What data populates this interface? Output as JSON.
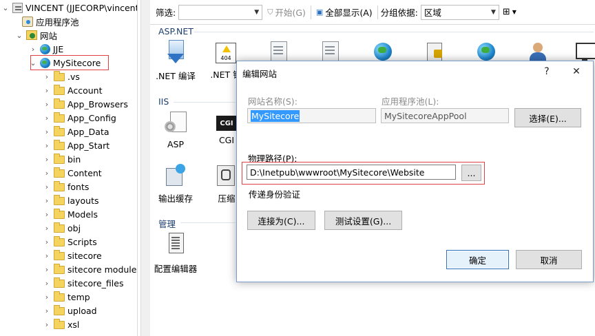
{
  "tree": {
    "server": "VINCENT (JJECORP\\vincent",
    "app_pools": "应用程序池",
    "sites": "网站",
    "site_jje": "JJE",
    "site_selected": "MySitecore",
    "folders": [
      ".vs",
      "Account",
      "App_Browsers",
      "App_Config",
      "App_Data",
      "App_Start",
      "bin",
      "Content",
      "fonts",
      "layouts",
      "Models",
      "obj",
      "Scripts",
      "sitecore",
      "sitecore modules",
      "sitecore_files",
      "temp",
      "upload",
      "xsl"
    ]
  },
  "toolbar": {
    "filter_label": "筛选:",
    "filter_value": "",
    "start_label": "开始(G)",
    "show_all_label": "全部显示(A)",
    "group_label": "分组依据:",
    "group_value": "区域"
  },
  "sections": {
    "aspnet": "ASP.NET",
    "iis": "IIS",
    "manage": "管理"
  },
  "features": {
    "net_compile": ".NET 编译",
    "net_error": ".NET 错",
    "asp": "ASP",
    "cgi": "CGI",
    "cgi_icon_text": "CGI",
    "output_cache": "输出缓存",
    "compress": "压缩",
    "config_editor": "配置编辑器"
  },
  "dialog": {
    "title": "编辑网站",
    "help": "?",
    "close": "✕",
    "site_name_label": "网站名称(S):",
    "site_name_value": "MySitecore",
    "app_pool_label": "应用程序池(L):",
    "app_pool_value": "MySitecoreAppPool",
    "select_button": "选择(E)...",
    "physical_path_label": "物理路径(P):",
    "physical_path_value": "D:\\Inetpub\\wwwroot\\MySitecore\\Website",
    "browse_button": "...",
    "pass_through_label": "传递身份验证",
    "connect_as_button": "连接为(C)...",
    "test_settings_button": "测试设置(G)...",
    "ok_button": "确定",
    "cancel_button": "取消"
  }
}
